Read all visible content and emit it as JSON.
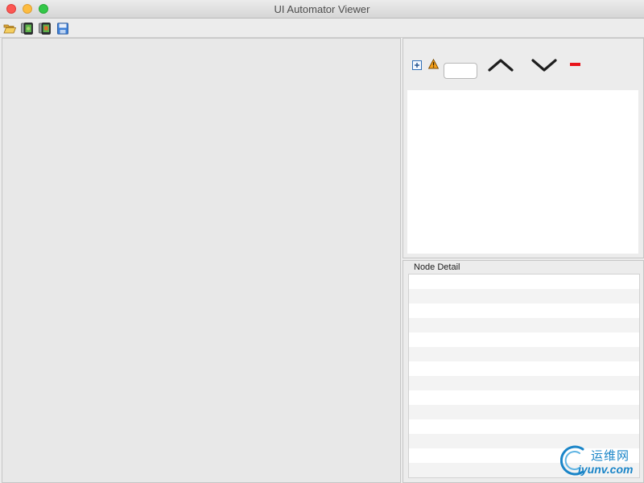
{
  "window": {
    "title": "UI Automator Viewer"
  },
  "toolbar": {
    "items": [
      {
        "name": "open-icon",
        "label": "Open"
      },
      {
        "name": "device-screenshot-icon",
        "label": "Device Screenshot"
      },
      {
        "name": "device-screenshot-compressed-icon",
        "label": "Device Screenshot (compressed)"
      },
      {
        "name": "save-icon",
        "label": "Save"
      }
    ]
  },
  "hierarchy_toolbar": {
    "expand_icon": "expand-all-icon",
    "warning_icon": "nafs-warning-icon",
    "search": {
      "value": "",
      "placeholder": ""
    },
    "prev_icon": "chevron-up-icon",
    "next_icon": "chevron-down-icon",
    "clear_icon": "minus-icon"
  },
  "node_detail": {
    "title": "Node Detail"
  },
  "watermark": {
    "cn": "运维网",
    "en": "iyunv.com"
  },
  "colors": {
    "accent_red": "#e8141b",
    "watermark_blue": "#1a85c8"
  }
}
